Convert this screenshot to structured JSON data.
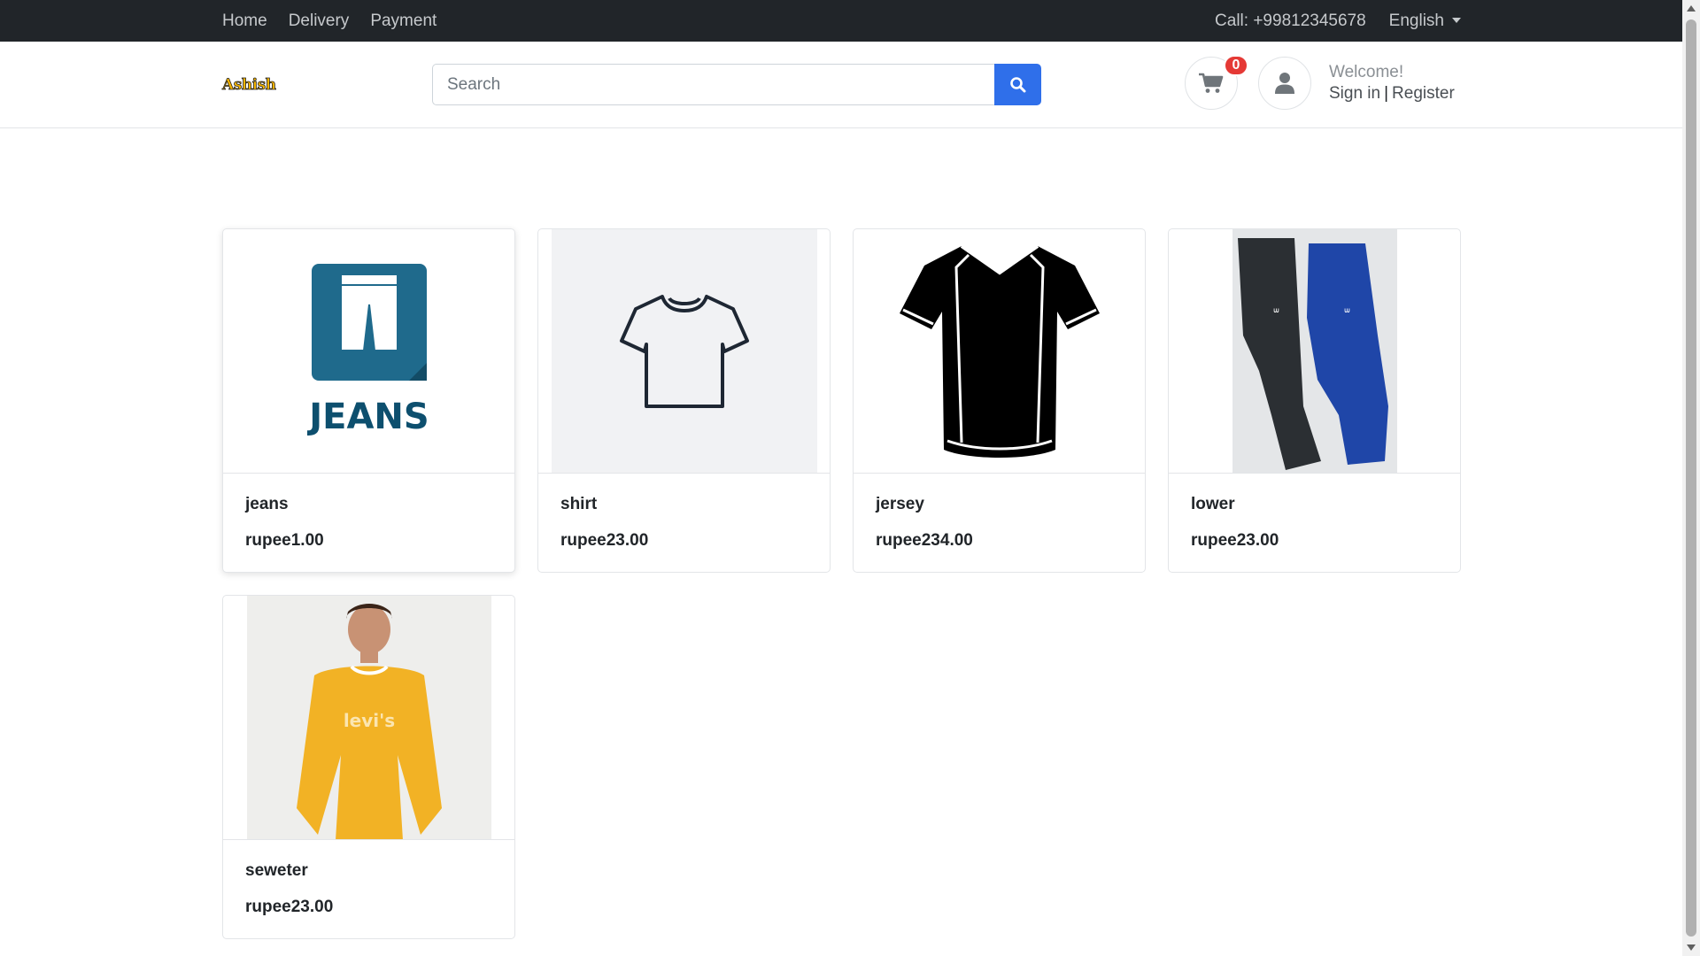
{
  "topbar": {
    "nav": [
      "Home",
      "Delivery",
      "Payment"
    ],
    "phone": "Call: +99812345678",
    "language": "English"
  },
  "header": {
    "logo": "Ashish",
    "search_placeholder": "Search",
    "search_value": "",
    "cart_count": "0",
    "welcome": "Welcome!",
    "sign_in": "Sign in",
    "separator": "|",
    "register": "Register"
  },
  "products": [
    {
      "name": "jeans",
      "price": "rupee1.00",
      "icon": "jeans-image"
    },
    {
      "name": "shirt",
      "price": "rupee23.00",
      "icon": "shirt-image"
    },
    {
      "name": "jersey",
      "price": "rupee234.00",
      "icon": "jersey-image"
    },
    {
      "name": "lower",
      "price": "rupee23.00",
      "icon": "lower-image"
    },
    {
      "name": "seweter",
      "price": "rupee23.00",
      "icon": "sweater-image"
    }
  ],
  "colors": {
    "topbar_bg": "#212529",
    "search_button": "#2f6fea",
    "badge": "#e53935"
  }
}
